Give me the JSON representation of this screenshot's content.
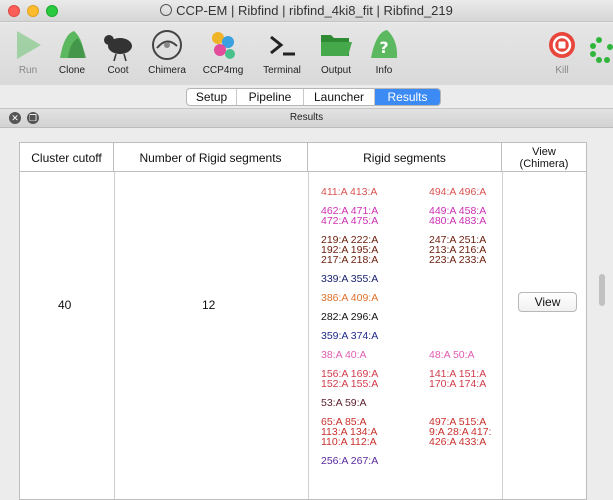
{
  "window": {
    "title": "CCP-EM | Ribfind | ribfind_4ki8_fit | Ribfind_219"
  },
  "toolbar": {
    "items": [
      {
        "label": "Run",
        "icon": "play-icon",
        "color": "#5bbd63"
      },
      {
        "label": "Clone",
        "icon": "clone-icon",
        "color": "#59b65f"
      },
      {
        "label": "Coot",
        "icon": "coot-bird-icon",
        "color": "#333333"
      },
      {
        "label": "Chimera",
        "icon": "chimera-icon",
        "color": "#555555"
      },
      {
        "label": "CCP4mg",
        "icon": "ccp4mg-icon",
        "color": "#3aa0e0"
      },
      {
        "label": "Terminal",
        "icon": "terminal-icon",
        "color": "#222222"
      },
      {
        "label": "Output",
        "icon": "folder-icon",
        "color": "#3c9a3a"
      },
      {
        "label": "Info",
        "icon": "info-icon",
        "color": "#5bbd63"
      },
      {
        "label": "Kill",
        "icon": "stop-icon",
        "color": "#e8453c"
      }
    ]
  },
  "tabs": [
    {
      "label": "Setup",
      "active": false
    },
    {
      "label": "Pipeline",
      "active": false
    },
    {
      "label": "Launcher",
      "active": false
    },
    {
      "label": "Results",
      "active": true
    }
  ],
  "results": {
    "title": "Results",
    "columns": [
      "Cluster cutoff",
      "Number of Rigid segments",
      "Rigid segments",
      "View\n(Chimera)"
    ],
    "row": {
      "cutoff": "40",
      "num_segments": "12",
      "view_label": "View",
      "segments": [
        {
          "left": [
            "411:A 413:A"
          ],
          "right": [
            "494:A 496:A"
          ],
          "color_left": "#d9534f",
          "color_right": "#d9534f"
        },
        {
          "left": [
            "462:A 471:A",
            "472:A 475:A"
          ],
          "right": [
            "449:A 458:A",
            "480:A 483:A"
          ],
          "color_left": "#cc2fb4",
          "color_right": "#cc2fb4"
        },
        {
          "left": [
            "219:A 222:A",
            "192:A 195:A",
            "217:A 218:A"
          ],
          "right": [
            "247:A 251:A",
            "213:A 216:A",
            "223:A 233:A"
          ],
          "color_left": "#6b1d0c",
          "color_right": "#6b1d0c"
        },
        {
          "left": [
            "339:A 355:A"
          ],
          "right": [],
          "color_left": "#1b2470",
          "color_right": "#1b2470"
        },
        {
          "left": [
            "386:A 409:A"
          ],
          "right": [],
          "color_left": "#e0702a",
          "color_right": "#e0702a"
        },
        {
          "left": [
            "282:A 296:A"
          ],
          "right": [],
          "color_left": "#111111",
          "color_right": "#111111"
        },
        {
          "left": [
            "359:A 374:A"
          ],
          "right": [],
          "color_left": "#1f2a8a",
          "color_right": "#1f2a8a"
        },
        {
          "left": [
            "38:A 40:A"
          ],
          "right": [
            "48:A 50:A"
          ],
          "color_left": "#e05bb0",
          "color_right": "#e05bb0"
        },
        {
          "left": [
            "156:A 169:A",
            "152:A 155:A"
          ],
          "right": [
            "141:A 151:A",
            "170:A 174:A"
          ],
          "color_left": "#d13a4a",
          "color_right": "#d13a4a"
        },
        {
          "left": [
            "53:A 59:A"
          ],
          "right": [],
          "color_left": "#5a1f2a",
          "color_right": "#5a1f2a"
        },
        {
          "left": [
            "65:A 85:A",
            "113:A 134:A",
            "110:A 112:A"
          ],
          "right": [
            "497:A 515:A",
            "9:A 28:A 417:",
            "426:A 433:A"
          ],
          "color_left": "#c9302c",
          "color_right": "#c9302c"
        },
        {
          "left": [
            "256:A 267:A"
          ],
          "right": [],
          "color_left": "#5a2aa0",
          "color_right": "#5a2aa0"
        }
      ]
    }
  }
}
